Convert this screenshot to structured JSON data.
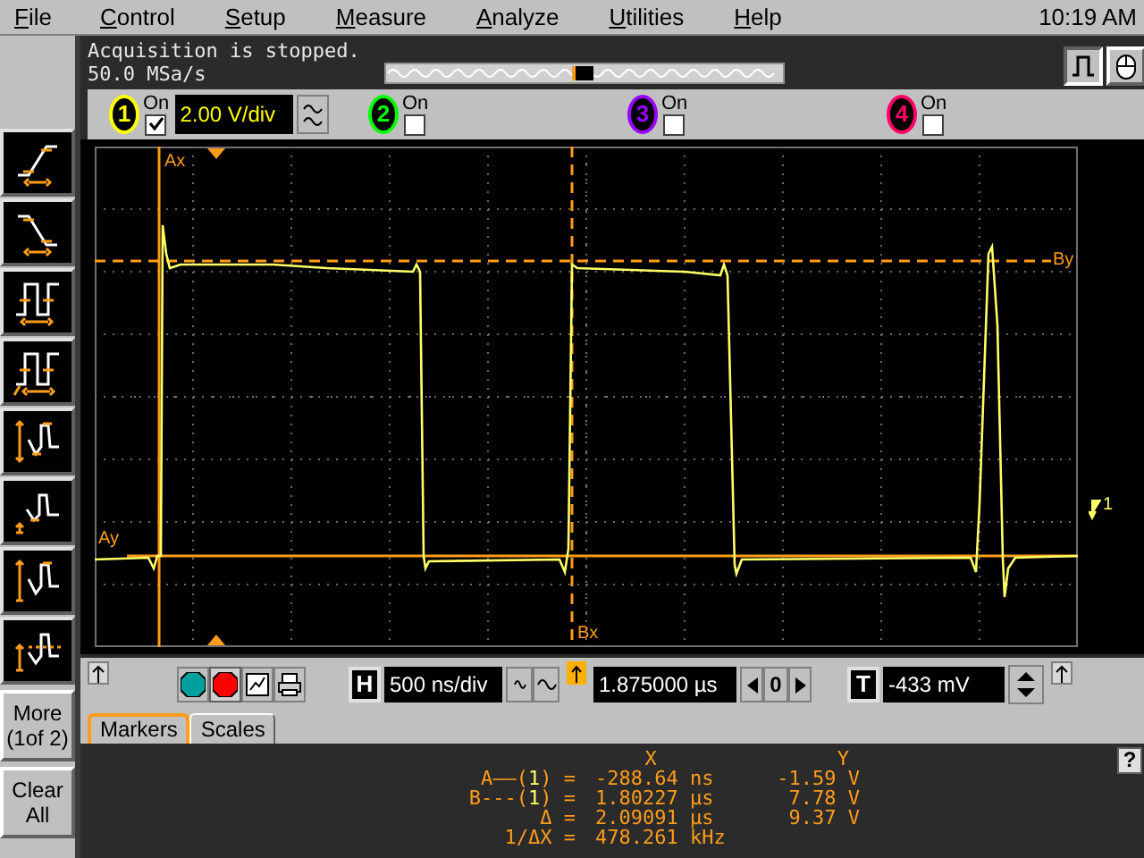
{
  "menu": [
    {
      "label": "File"
    },
    {
      "label": "Control"
    },
    {
      "label": "Setup"
    },
    {
      "label": "Measure"
    },
    {
      "label": "Analyze"
    },
    {
      "label": "Utilities"
    },
    {
      "label": "Help"
    }
  ],
  "clock": "10:19 AM",
  "status": {
    "lines": [
      "Acquisition is stopped.",
      "50.0 MSa/s"
    ]
  },
  "channels": [
    {
      "number": "1",
      "color": "#ffff00",
      "on_label": "On",
      "on": true,
      "scale": "2.00 V/div"
    },
    {
      "number": "2",
      "color": "#00ff00",
      "on_label": "On",
      "on": false
    },
    {
      "number": "3",
      "color": "#9900ff",
      "on_label": "On",
      "on": false
    },
    {
      "number": "4",
      "color": "#ff0066",
      "on_label": "On",
      "on": false
    }
  ],
  "scope": {
    "marker_labels": {
      "ax": "Ax",
      "bx": "Bx",
      "by": "By",
      "ay": "Ay"
    },
    "trigger_label": "1"
  },
  "sidebar": {
    "tools": [
      {
        "kind": "rise"
      },
      {
        "kind": "fall"
      },
      {
        "kind": "period"
      },
      {
        "kind": "frequency"
      },
      {
        "kind": "peak_to_peak"
      },
      {
        "kind": "minimum"
      },
      {
        "kind": "maximum"
      },
      {
        "kind": "average"
      }
    ],
    "buttons": [
      "More (1of 2)",
      "Clear All"
    ]
  },
  "horizontal": {
    "button": "H",
    "scale": "500 ns/div",
    "delay": "1.875000 µs",
    "zero": "0"
  },
  "trigger": {
    "button": "T",
    "level": "-433 mV"
  },
  "tabs": [
    {
      "label": "Markers",
      "selected": true
    },
    {
      "label": "Scales",
      "selected": false
    }
  ],
  "markers_table": {
    "columns": [
      "X",
      "Y"
    ],
    "rows": [
      {
        "prefix": "A——(",
        "channel": "1",
        "suffix": ") =",
        "x": "-288.64 ns",
        "y": "-1.59 V"
      },
      {
        "prefix": "B---(",
        "channel": "1",
        "suffix": ") =",
        "x": "1.80227 µs",
        "y": "7.78 V"
      },
      {
        "prefix": "Δ =",
        "x": "2.09091 µs",
        "y": "9.37 V"
      },
      {
        "prefix": "1/ΔX =",
        "x": "478.261 kHz"
      }
    ]
  },
  "help": "?"
}
